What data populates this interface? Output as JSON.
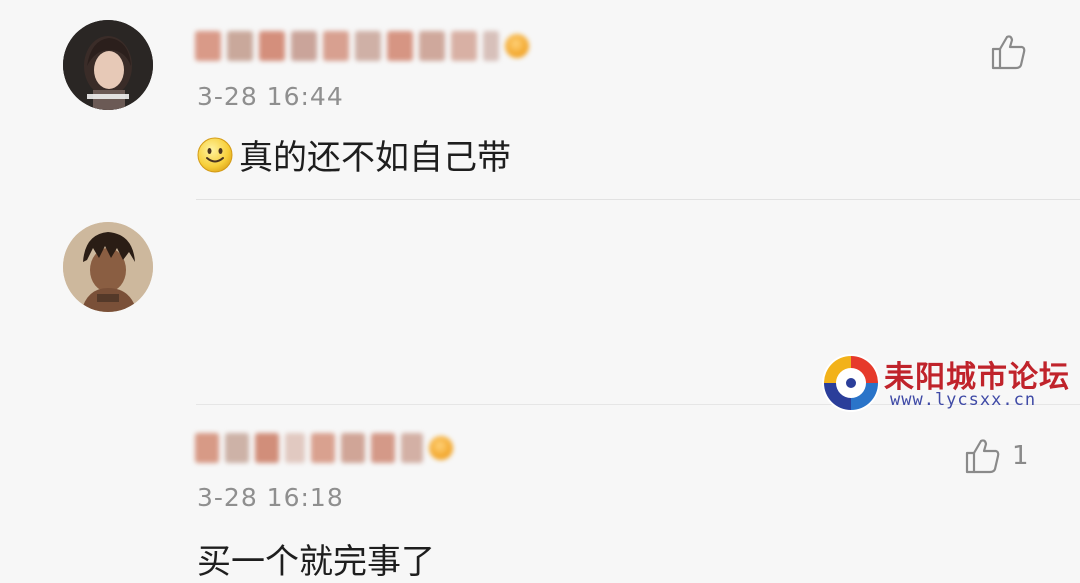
{
  "comments": [
    {
      "time": "3-28 16:44",
      "text": "真的还不如自己带",
      "like_count": "",
      "has_emoji": true
    },
    {
      "time": "3-28 16:18",
      "text": "买一个就完事了",
      "like_count": "1",
      "has_emoji": false
    }
  ],
  "watermark": {
    "title": "耒阳城市论坛",
    "url": "www.lycsxx.cn"
  },
  "icons": [
    "thumbs-up-icon",
    "smile-emoji-icon",
    "forum-logo-icon",
    "verified-badge-icon"
  ],
  "colors": {
    "background": "#f7f7f7",
    "text": "#1e1e1e",
    "meta": "#8f8f8f",
    "watermark_red": "#c0232b",
    "watermark_blue": "#3f4aa6"
  }
}
